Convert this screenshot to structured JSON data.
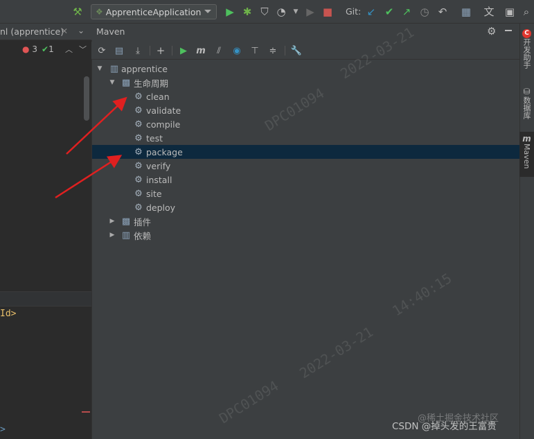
{
  "toolbar": {
    "run_config": "ApprenticeApplication",
    "git_label": "Git:"
  },
  "editor": {
    "tab_title": "nl (apprentice)",
    "error_count": "3",
    "ok_count": "1",
    "code_text": "Id",
    "code_gt": ">",
    "code_bottom": ">"
  },
  "maven": {
    "title": "Maven",
    "project": "apprentice",
    "lifecycle": "生命周期",
    "phases": [
      "clean",
      "validate",
      "compile",
      "test",
      "package",
      "verify",
      "install",
      "site",
      "deploy"
    ],
    "selected_phase": "package",
    "plugins": "插件",
    "dependencies": "依赖"
  },
  "right_strip": {
    "dev_helper": "开发助手",
    "database": "数据库",
    "maven": "Maven"
  },
  "watermarks": {
    "date_top": "2022-03-21",
    "id_top": "DPC01094",
    "time_mid": "14:40:15",
    "date_mid": "2022-03-21",
    "id_mid": "DPC01094",
    "csdn": "CSDN @掉头发的王富贵",
    "juejin": "@稀土掘金技术社区"
  },
  "colors": {
    "panel_bg": "#3c3f41",
    "editor_bg": "#2b2b2b",
    "selection": "#0d293e",
    "run_green": "#4ec05e",
    "stop_red": "#c75450",
    "annotation_red": "#e02020"
  }
}
